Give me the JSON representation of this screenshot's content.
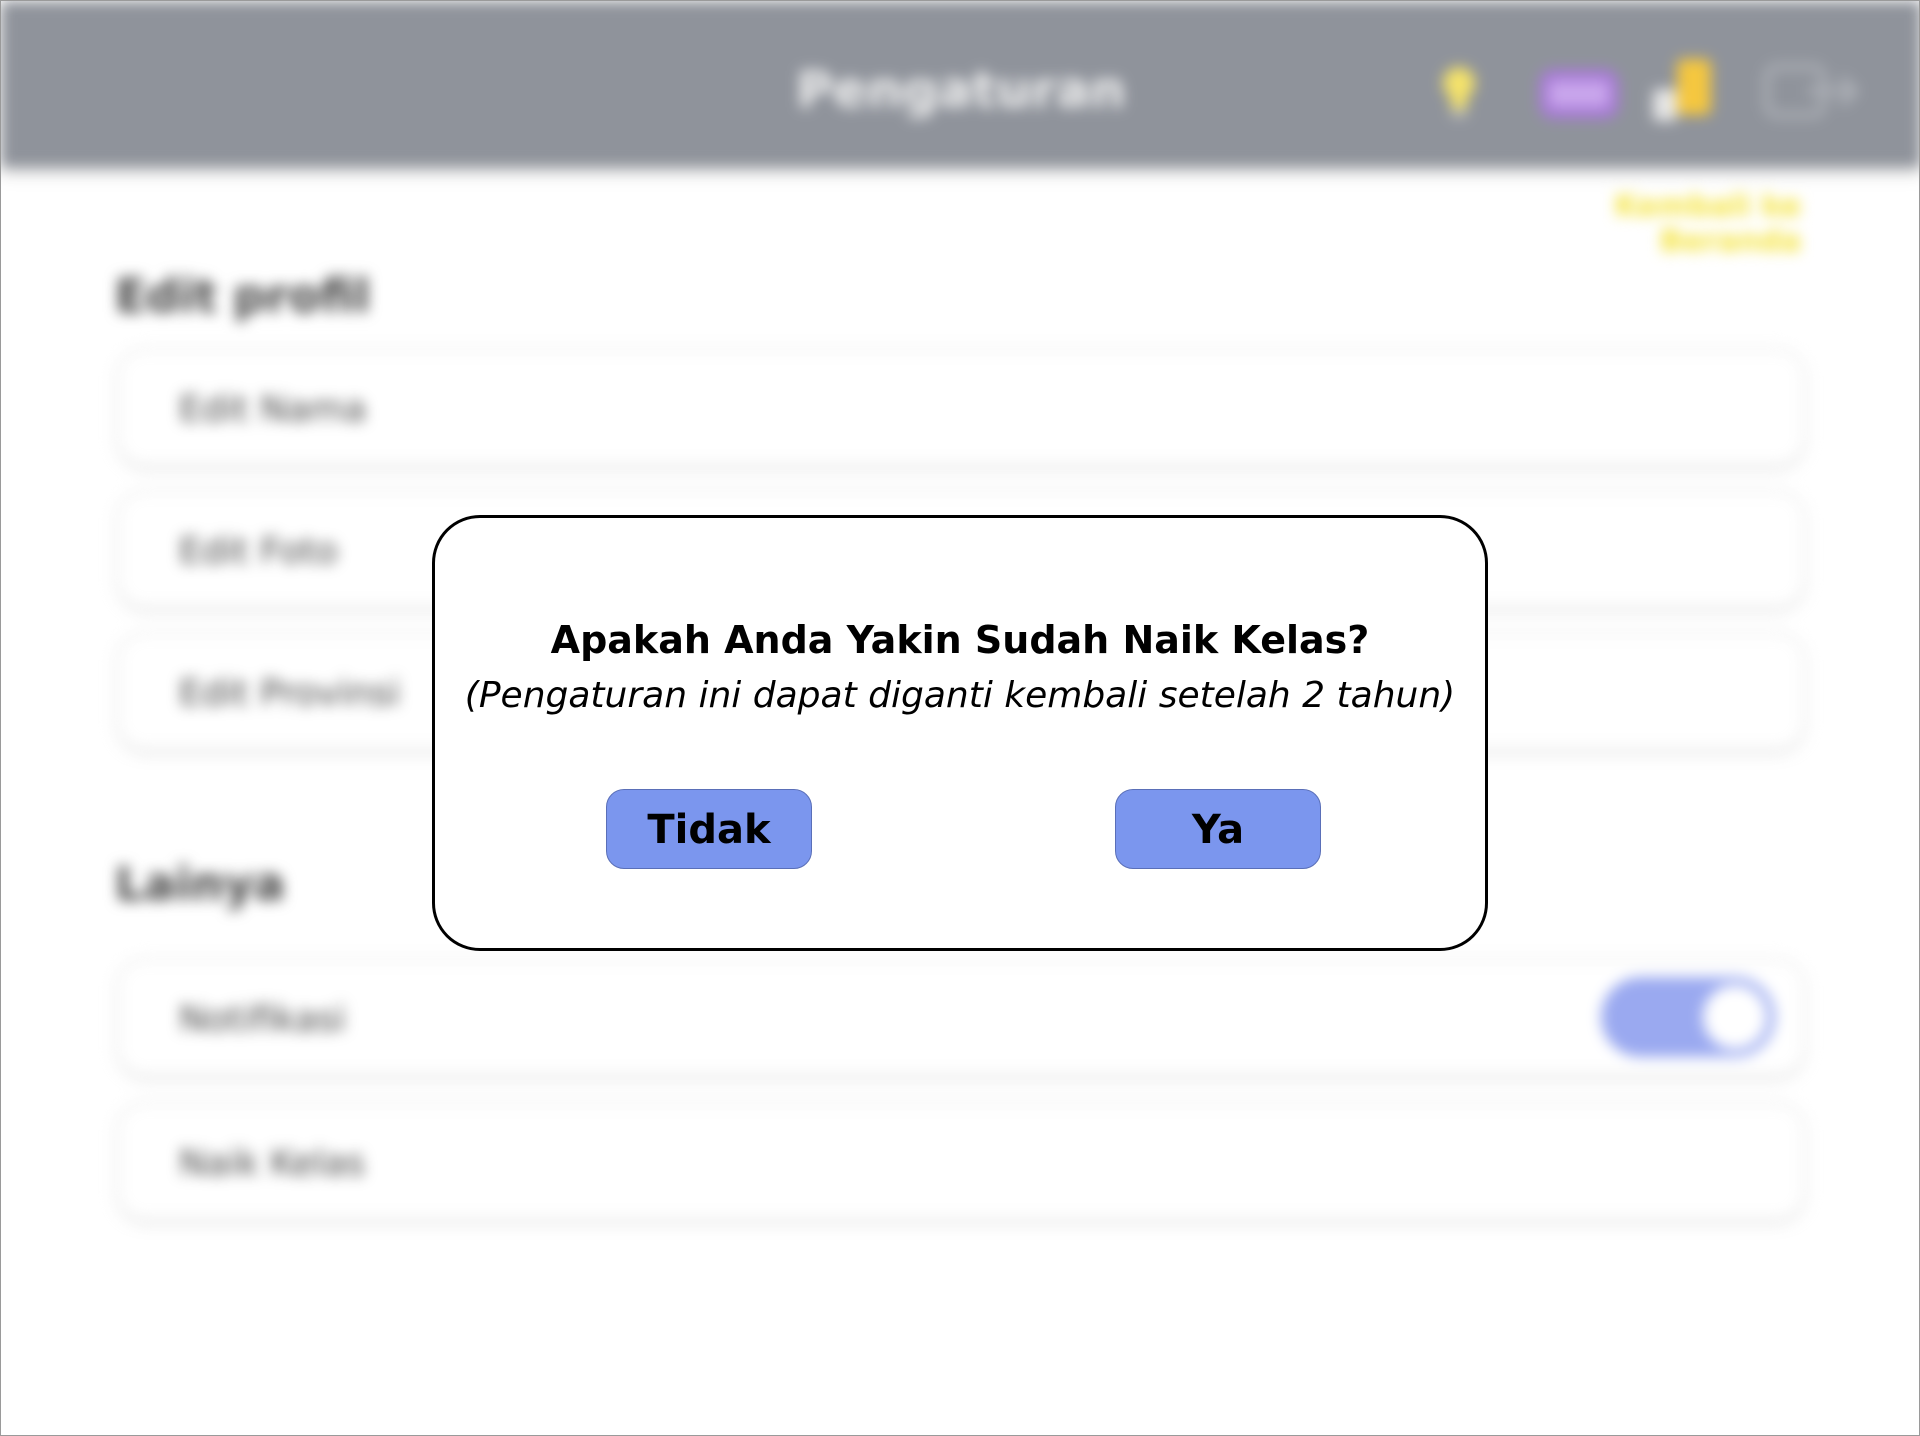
{
  "header": {
    "title": "Pengaturan",
    "icons": [
      "bulb-icon",
      "basket-icon",
      "trophy-icon",
      "exit-icon"
    ]
  },
  "top_link": "Kembali ke Beranda",
  "sections": {
    "edit_profile": {
      "title": "Edit profil",
      "items": [
        "Edit Nama",
        "Edit Foto",
        "Edit Provinsi"
      ]
    },
    "other": {
      "title": "Lainya",
      "items": [
        "Notifikasi",
        "Naik Kelas"
      ],
      "notification_toggle_on": true
    }
  },
  "dialog": {
    "title": "Apakah Anda Yakin Sudah Naik Kelas?",
    "subtitle": "(Pengaturan ini dapat diganti kembali setelah 2 tahun)",
    "cancel_label": "Tidak",
    "confirm_label": "Ya"
  },
  "colors": {
    "header_bg": "#8f939b",
    "button_bg": "#7b96ee",
    "toggle_bg": "#9aa9f0",
    "link": "#f4e33a"
  }
}
